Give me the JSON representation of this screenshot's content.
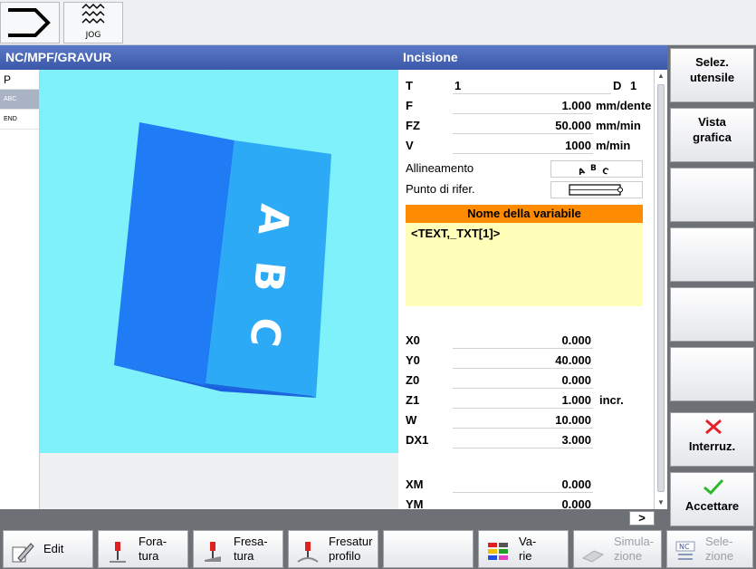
{
  "topbar": {
    "jog_label": "JOG"
  },
  "title": {
    "path": "NC/MPF/GRAVUR",
    "cycle": "Incisione"
  },
  "left_strip": [
    "P",
    "ABC",
    "END"
  ],
  "graphic": {
    "letters": [
      "A",
      "B",
      "C"
    ]
  },
  "params": {
    "T": {
      "label": "T",
      "value": "1",
      "d_label": "D",
      "d_value": "1"
    },
    "F": {
      "label": "F",
      "value": "1.000",
      "unit": "mm/dente"
    },
    "FZ": {
      "label": "FZ",
      "value": "50.000",
      "unit": "mm/min"
    },
    "V": {
      "label": "V",
      "value": "1000",
      "unit": "m/min"
    },
    "alignment_label": "Allineamento",
    "alignment_icon_text": "ABC",
    "refpoint_label": "Punto di rifer.",
    "varname_header": "Nome della variabile",
    "varname_text": "<TEXT,_TXT[1]>",
    "X0": {
      "label": "X0",
      "value": "0.000"
    },
    "Y0": {
      "label": "Y0",
      "value": "40.000"
    },
    "Z0": {
      "label": "Z0",
      "value": "0.000"
    },
    "Z1": {
      "label": "Z1",
      "value": "1.000",
      "unit": "incr."
    },
    "W": {
      "label": "W",
      "value": "10.000"
    },
    "DX1": {
      "label": "DX1",
      "value": "3.000"
    },
    "XM": {
      "label": "XM",
      "value": "0.000"
    },
    "YM": {
      "label": "YM",
      "value": "0.000"
    }
  },
  "scroll_right_label": ">",
  "vsoft": {
    "key1": [
      "Selez.",
      "utensile"
    ],
    "key2": [
      "Vista",
      "grafica"
    ],
    "interrupt": "Interruz.",
    "accept": "Accettare"
  },
  "hsoft": {
    "edit": "Edit",
    "drilling": [
      "Fora-",
      "tura"
    ],
    "milling": [
      "Fresa-",
      "tura"
    ],
    "contour": [
      "Fresatur",
      "profilo"
    ],
    "various": [
      "Va-",
      "rie"
    ],
    "simulation": [
      "Simula-",
      "zione"
    ],
    "nc_icon": "NC",
    "selection": [
      "Sele-",
      "zione"
    ]
  },
  "colors": {
    "title_bar": "#3b57a8",
    "graphic_bg": "#7ff1fb",
    "block_front": "#1f7cf4",
    "block_side": "#2daaf6",
    "varname_header": "#ff8c00",
    "varname_box": "#ffffb9"
  }
}
